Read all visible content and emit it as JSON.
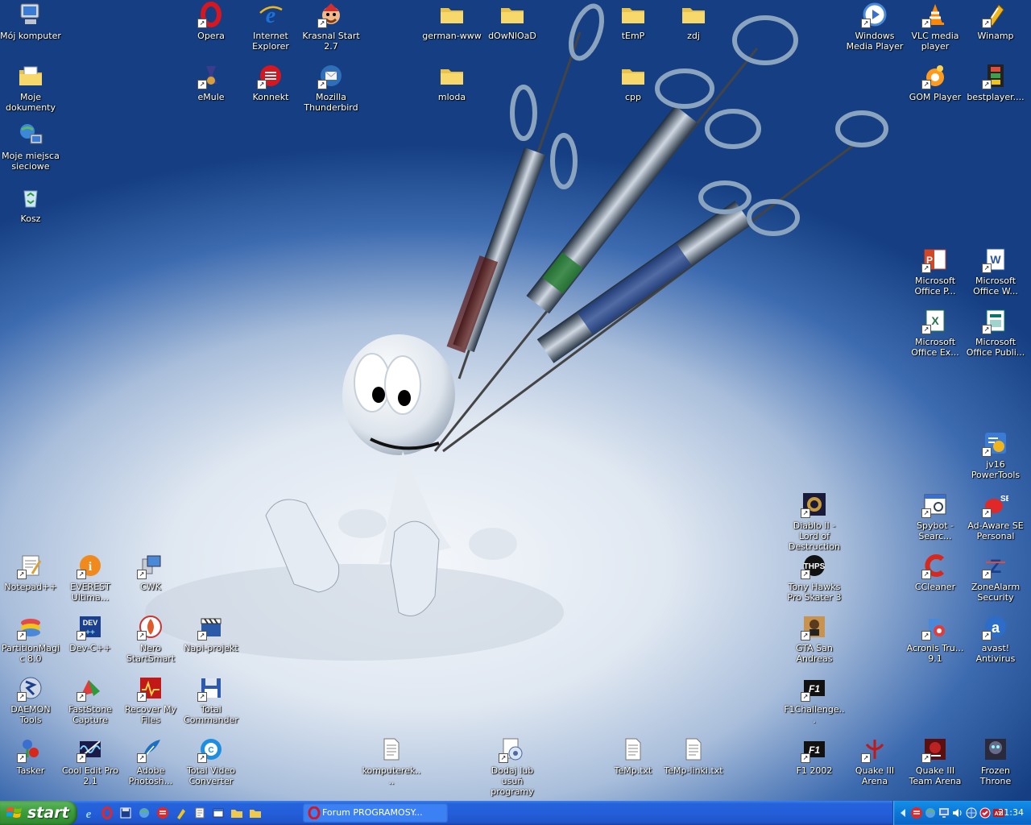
{
  "desktop": {
    "icons": [
      {
        "id": "my-computer",
        "label": "Mój komputer",
        "icon": "computer-icon",
        "shortcut": false
      },
      {
        "id": "my-documents",
        "label": "Moje dokumenty",
        "icon": "documents-folder-icon",
        "shortcut": false
      },
      {
        "id": "network-places",
        "label": "Moje miejsca sieciowe",
        "icon": "network-icon",
        "shortcut": false
      },
      {
        "id": "recycle-bin",
        "label": "Kosz",
        "icon": "recycle-bin-icon",
        "shortcut": false
      },
      {
        "id": "opera",
        "label": "Opera",
        "icon": "opera-icon",
        "shortcut": true
      },
      {
        "id": "internet-explorer",
        "label": "Internet Explorer",
        "icon": "internet-explorer-icon",
        "shortcut": false
      },
      {
        "id": "krasnal-start",
        "label": "Krasnal Start 2.7",
        "icon": "krasnal-icon",
        "shortcut": true
      },
      {
        "id": "emule",
        "label": "eMule",
        "icon": "emule-icon",
        "shortcut": true
      },
      {
        "id": "konnekt",
        "label": "Konnekt",
        "icon": "konnekt-icon",
        "shortcut": true
      },
      {
        "id": "thunderbird",
        "label": "Mozilla Thunderbird",
        "icon": "thunderbird-icon",
        "shortcut": true
      },
      {
        "id": "german-www",
        "label": "german-www",
        "icon": "folder-icon",
        "shortcut": false
      },
      {
        "id": "download",
        "label": "dOwNlOaD",
        "icon": "folder-icon",
        "shortcut": false
      },
      {
        "id": "mloda",
        "label": "mloda",
        "icon": "folder-icon",
        "shortcut": false
      },
      {
        "id": "temp",
        "label": "tEmP",
        "icon": "folder-icon",
        "shortcut": false
      },
      {
        "id": "zdj",
        "label": "zdj",
        "icon": "folder-icon",
        "shortcut": false
      },
      {
        "id": "cpp",
        "label": "cpp",
        "icon": "folder-icon",
        "shortcut": false
      },
      {
        "id": "wmp",
        "label": "Windows Media Player",
        "icon": "media-player-icon",
        "shortcut": true
      },
      {
        "id": "vlc",
        "label": "VLC media player",
        "icon": "vlc-cone-icon",
        "shortcut": true
      },
      {
        "id": "winamp",
        "label": "Winamp",
        "icon": "winamp-icon",
        "shortcut": true
      },
      {
        "id": "gom",
        "label": "GOM Player",
        "icon": "gom-player-icon",
        "shortcut": true
      },
      {
        "id": "bestplayer",
        "label": "bestplayer....",
        "icon": "film-strip-icon",
        "shortcut": true
      },
      {
        "id": "ms-powerpoint",
        "label": "Microsoft Office P...",
        "icon": "powerpoint-icon",
        "shortcut": true
      },
      {
        "id": "ms-word",
        "label": "Microsoft Office W...",
        "icon": "word-icon",
        "shortcut": true
      },
      {
        "id": "ms-excel",
        "label": "Microsoft Office Ex...",
        "icon": "excel-icon",
        "shortcut": true
      },
      {
        "id": "ms-publisher",
        "label": "Microsoft Office Publi...",
        "icon": "publisher-icon",
        "shortcut": true
      },
      {
        "id": "jv16",
        "label": "jv16 PowerTools",
        "icon": "jv16-icon",
        "shortcut": true
      },
      {
        "id": "diablo2",
        "label": "Diablo II - Lord of Destruction",
        "icon": "diablo-icon",
        "shortcut": true
      },
      {
        "id": "spybot",
        "label": "Spybot - Searc...",
        "icon": "spybot-icon",
        "shortcut": true
      },
      {
        "id": "adaware",
        "label": "Ad-Aware SE Personal",
        "icon": "adaware-icon",
        "shortcut": true
      },
      {
        "id": "tony-hawk",
        "label": "Tony Hawks Pro Skater 3",
        "icon": "thps-icon",
        "shortcut": true
      },
      {
        "id": "ccleaner",
        "label": "CCleaner",
        "icon": "ccleaner-icon",
        "shortcut": true
      },
      {
        "id": "zonealarm",
        "label": "ZoneAlarm Security",
        "icon": "zonealarm-icon",
        "shortcut": true
      },
      {
        "id": "gta-sa",
        "label": "GTA San Andreas",
        "icon": "gta-icon",
        "shortcut": true
      },
      {
        "id": "acronis",
        "label": "Acronis Tru... 9.1",
        "icon": "acronis-icon",
        "shortcut": true
      },
      {
        "id": "avast",
        "label": "avast! Antivirus",
        "icon": "avast-icon",
        "shortcut": true
      },
      {
        "id": "f1-challenge",
        "label": "F1Challenge...",
        "icon": "f1-icon",
        "shortcut": true
      },
      {
        "id": "notepadpp",
        "label": "Notepad++",
        "icon": "notepad-icon",
        "shortcut": true
      },
      {
        "id": "everest",
        "label": "EVEREST Ultima...",
        "icon": "everest-icon",
        "shortcut": true
      },
      {
        "id": "cwk",
        "label": "CWK",
        "icon": "cwk-icon",
        "shortcut": true
      },
      {
        "id": "partitionmagic",
        "label": "PartitionMagic 8.0",
        "icon": "partition-icon",
        "shortcut": true
      },
      {
        "id": "devcpp",
        "label": "Dev-C++",
        "icon": "devcpp-icon",
        "shortcut": true
      },
      {
        "id": "nero",
        "label": "Nero StartSmart",
        "icon": "nero-icon",
        "shortcut": true
      },
      {
        "id": "napi",
        "label": "Napi-projekt",
        "icon": "clapperboard-icon",
        "shortcut": true
      },
      {
        "id": "daemon",
        "label": "DAEMON Tools",
        "icon": "daemon-icon",
        "shortcut": true
      },
      {
        "id": "faststone",
        "label": "FastStone Capture",
        "icon": "faststone-icon",
        "shortcut": true
      },
      {
        "id": "recover",
        "label": "Recover My Files",
        "icon": "recover-icon",
        "shortcut": true
      },
      {
        "id": "totalcmd",
        "label": "Total Commander",
        "icon": "floppy-icon",
        "shortcut": true
      },
      {
        "id": "tasker",
        "label": "Tasker",
        "icon": "tasker-icon",
        "shortcut": true
      },
      {
        "id": "cooledit",
        "label": "Cool Edit Pro 2.1",
        "icon": "cooledit-icon",
        "shortcut": true
      },
      {
        "id": "photoshop",
        "label": "Adobe Photosh...",
        "icon": "feather-icon",
        "shortcut": true
      },
      {
        "id": "tvc",
        "label": "Total Video Converter",
        "icon": "tvc-icon",
        "shortcut": true
      },
      {
        "id": "komputerek",
        "label": "komputerek....",
        "icon": "text-file-icon",
        "shortcut": false
      },
      {
        "id": "addremove",
        "label": "Dodaj lub usuń programy",
        "icon": "add-remove-icon",
        "shortcut": true
      },
      {
        "id": "temp-txt",
        "label": "TeMp.txt",
        "icon": "text-file-icon",
        "shortcut": false
      },
      {
        "id": "temp-linki",
        "label": "TeMp-linki.txt",
        "icon": "text-file-icon",
        "shortcut": false
      },
      {
        "id": "f1-2002",
        "label": "F1 2002",
        "icon": "f1-icon",
        "shortcut": true
      },
      {
        "id": "quake3",
        "label": "Quake III Arena",
        "icon": "quake-icon",
        "shortcut": true
      },
      {
        "id": "quake3-team",
        "label": "Quake III Team Arena",
        "icon": "quake-team-icon",
        "shortcut": true
      },
      {
        "id": "frozen-throne",
        "label": "Frozen Throne",
        "icon": "warcraft-icon",
        "shortcut": false
      }
    ]
  },
  "taskbar": {
    "start_label": "start",
    "quick_launch": [
      "internet-explorer-icon",
      "opera-icon",
      "save-icon",
      "network-icon",
      "konnekt-icon",
      "winamp-icon",
      "notepad-icon",
      "window-icon",
      "folder-icon",
      "folder-icon"
    ],
    "window_button": {
      "label": "Forum PROGRAMOSY...",
      "icon": "opera-icon"
    },
    "tray_icons": [
      "tray-expand-icon",
      "konnekt-icon",
      "network-icon",
      "monitor-icon",
      "volume-icon",
      "globe-icon",
      "security-icon",
      "ati-icon"
    ],
    "clock": "21:34"
  },
  "colors": {
    "taskbar": "#245edb",
    "start": "#3c9c3c",
    "tray": "#0c77d6",
    "wallpaper_dark": "#153f82"
  }
}
